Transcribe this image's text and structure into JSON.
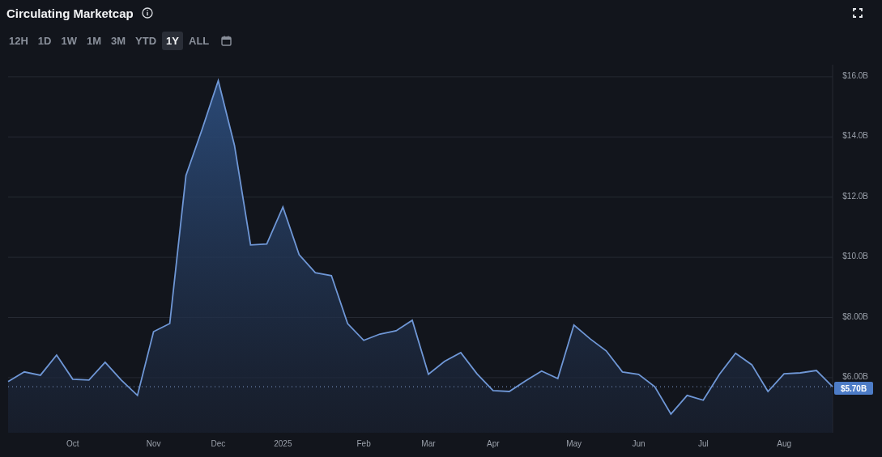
{
  "title": "Circulating Marketcap",
  "ranges": [
    {
      "label": "12H",
      "selected": false
    },
    {
      "label": "1D",
      "selected": false
    },
    {
      "label": "1W",
      "selected": false
    },
    {
      "label": "1M",
      "selected": false
    },
    {
      "label": "3M",
      "selected": false
    },
    {
      "label": "YTD",
      "selected": false
    },
    {
      "label": "1Y",
      "selected": true
    },
    {
      "label": "ALL",
      "selected": false
    }
  ],
  "chart": {
    "chart_data": {
      "type": "area",
      "categories": [
        null,
        null,
        null,
        null,
        "Oct",
        null,
        null,
        null,
        null,
        "Nov",
        null,
        null,
        null,
        "Dec",
        null,
        null,
        null,
        "2025",
        null,
        null,
        null,
        null,
        "Feb",
        null,
        null,
        null,
        "Mar",
        null,
        null,
        null,
        "Apr",
        null,
        null,
        null,
        null,
        "May",
        null,
        null,
        null,
        "Jun",
        null,
        null,
        null,
        "Jul",
        null,
        null,
        null,
        null,
        "Aug",
        null,
        null,
        null
      ],
      "series": [
        {
          "color": "#6f97d6",
          "values": [
            5.87,
            6.19,
            6.08,
            6.75,
            5.95,
            5.92,
            6.51,
            5.92,
            5.41,
            7.53,
            7.8,
            12.72,
            14.25,
            15.87,
            13.72,
            10.41,
            10.44,
            11.67,
            10.09,
            9.49,
            9.39,
            7.8,
            7.24,
            7.45,
            7.56,
            7.91,
            6.11,
            6.54,
            6.83,
            6.13,
            5.57,
            5.54,
            5.89,
            6.22,
            5.97,
            7.75,
            7.29,
            6.89,
            6.19,
            6.11,
            5.7,
            4.79,
            5.41,
            5.25,
            6.11,
            6.81,
            6.43,
            5.54,
            6.13,
            6.16,
            6.24,
            5.7
          ]
        }
      ],
      "grid": true,
      "ylim": [
        4.17,
        16.4
      ],
      "yticks": [
        {
          "value": 6,
          "label": "$6.00B"
        },
        {
          "value": 8,
          "label": "$8.00B"
        },
        {
          "value": 10,
          "label": "$10.0B"
        },
        {
          "value": 12,
          "label": "$12.0B"
        },
        {
          "value": 14,
          "label": "$14.0B"
        },
        {
          "value": 16,
          "label": "$16.0B"
        }
      ],
      "annotations": [
        "$5.70B"
      ]
    }
  }
}
